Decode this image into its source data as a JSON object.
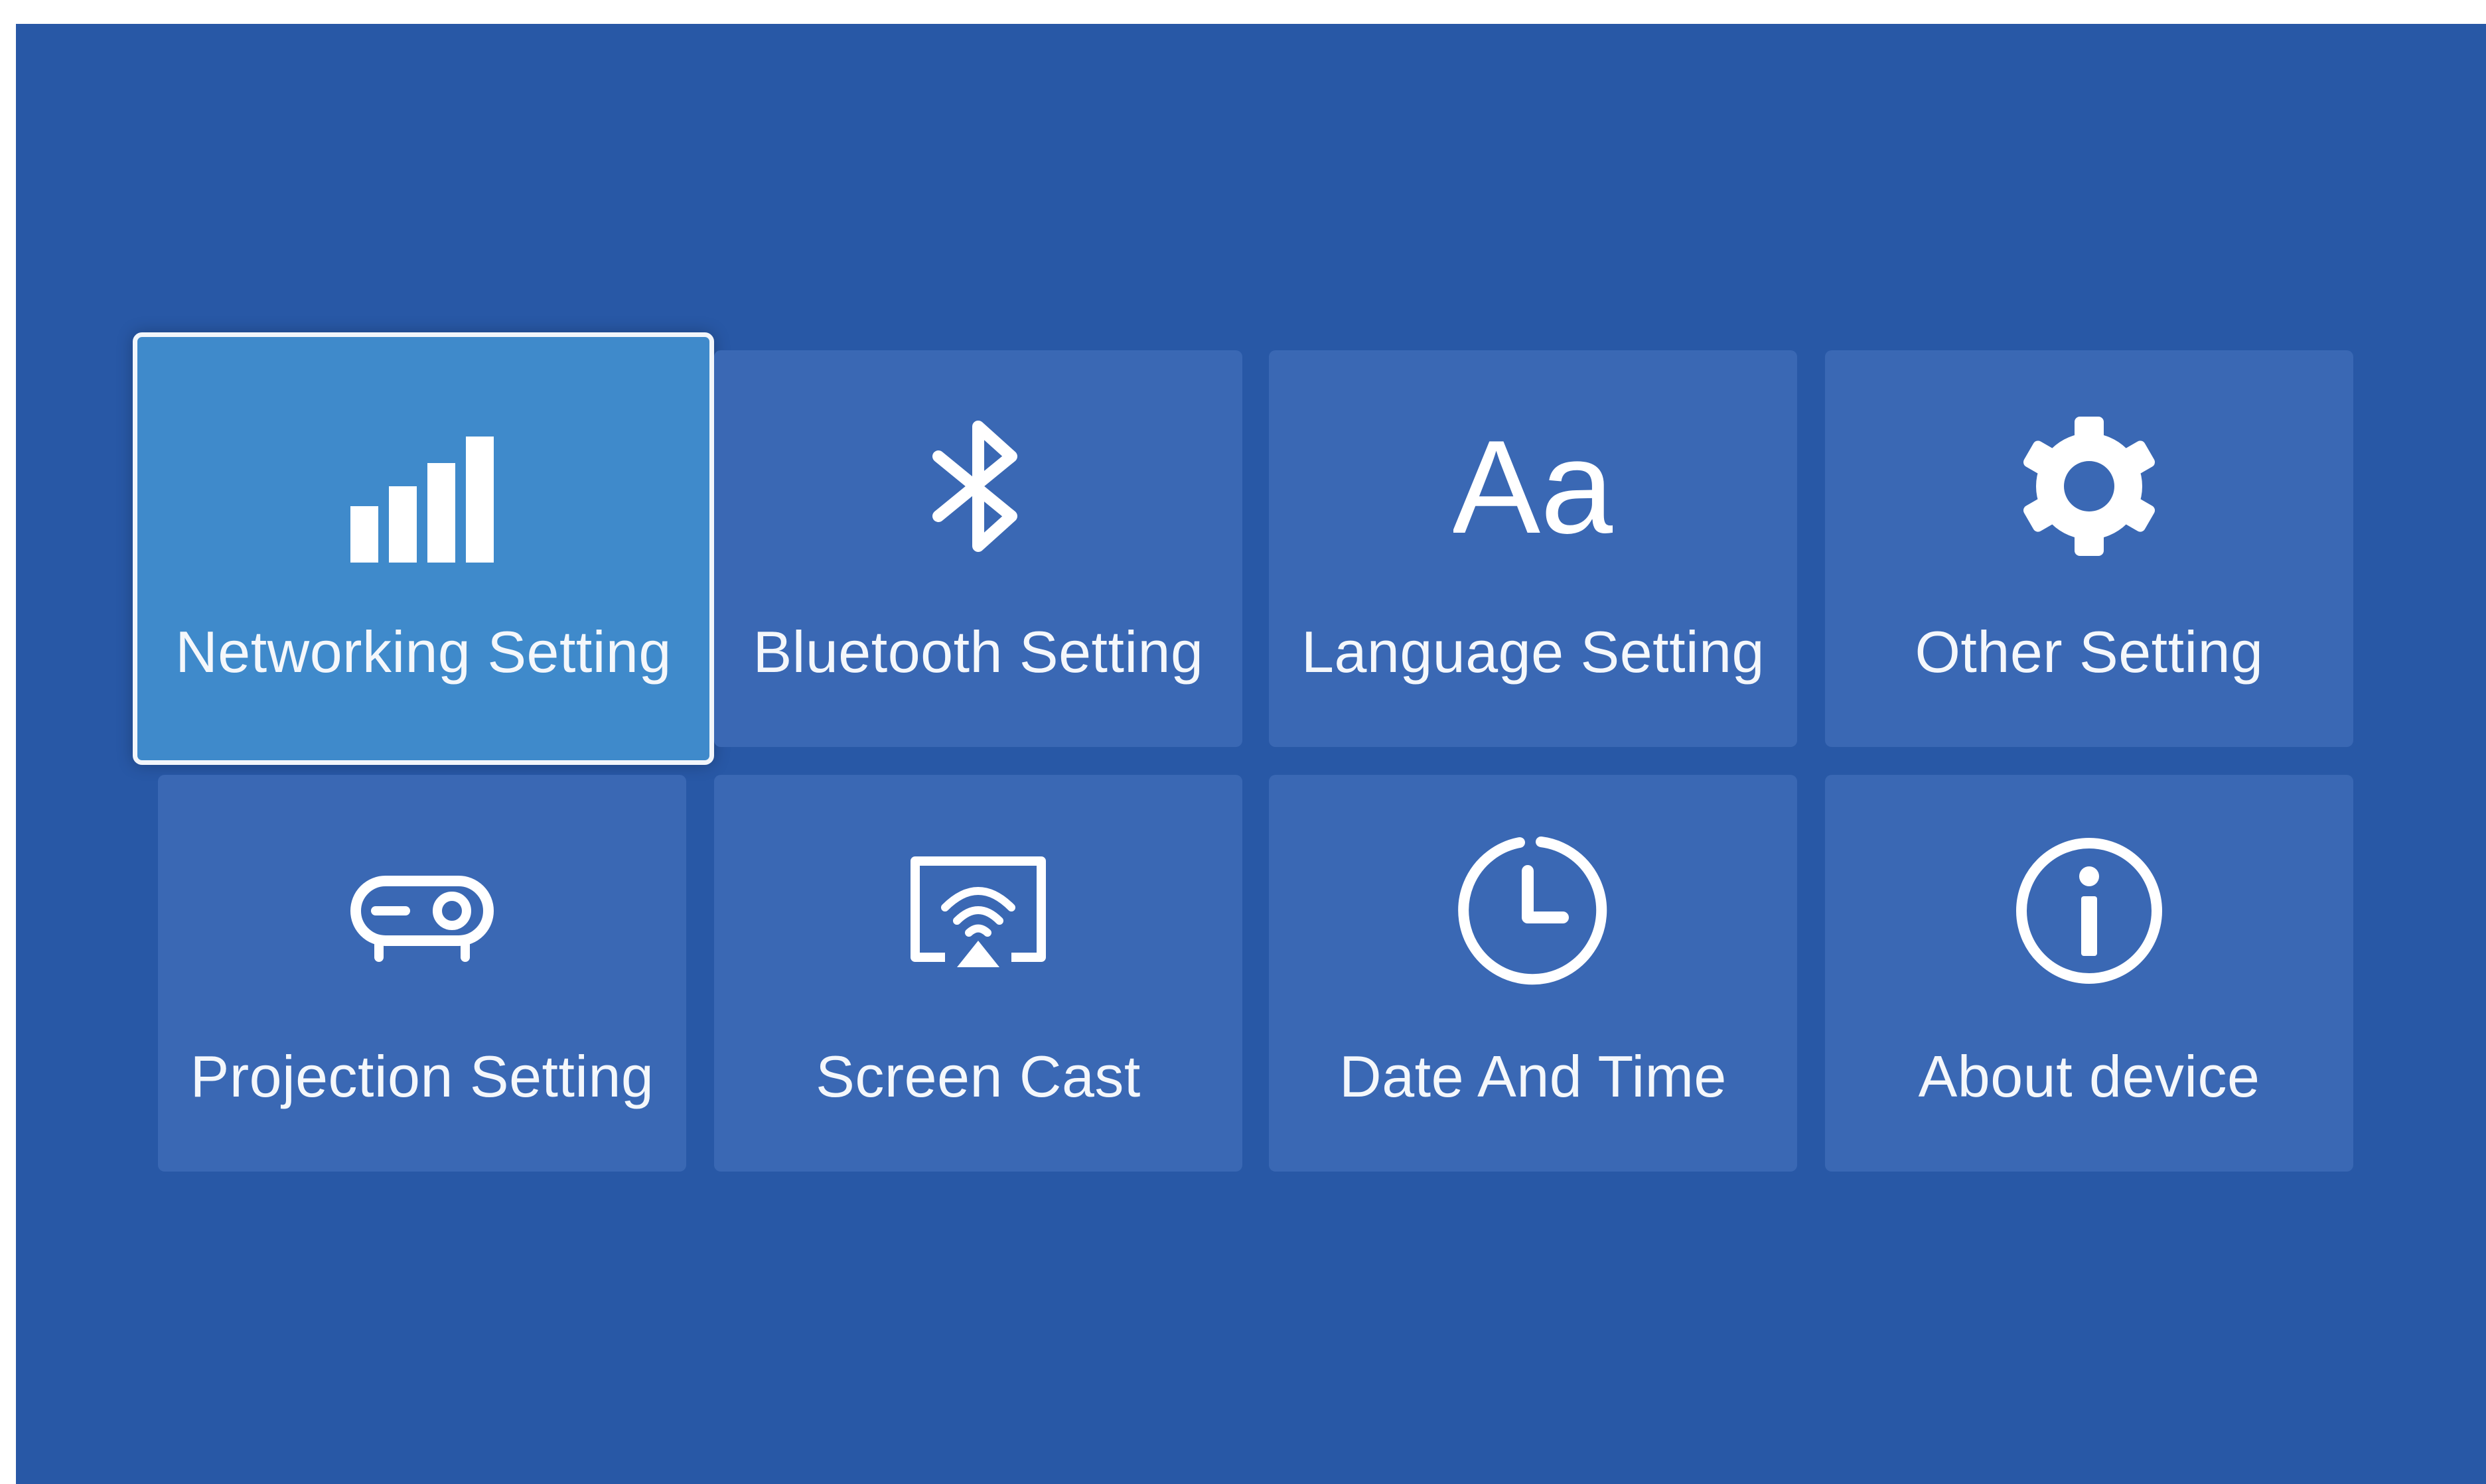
{
  "tiles": [
    {
      "label": "Networking Setting",
      "icon": "signal-bars-icon",
      "selected": true
    },
    {
      "label": "Bluetooth Setting",
      "icon": "bluetooth-icon",
      "selected": false
    },
    {
      "label": "Language Setting",
      "icon": "language-aa-icon",
      "selected": false
    },
    {
      "label": "Other Setting",
      "icon": "gear-icon",
      "selected": false
    },
    {
      "label": "Projection Setting",
      "icon": "projector-icon",
      "selected": false
    },
    {
      "label": "Screen Cast",
      "icon": "screen-cast-icon",
      "selected": false
    },
    {
      "label": "Date And Time",
      "icon": "clock-icon",
      "selected": false
    },
    {
      "label": "About device",
      "icon": "info-icon",
      "selected": false
    }
  ],
  "icons": {
    "language_glyph": "Aa"
  },
  "colors": {
    "background": "#2858a6",
    "tile": "#3a68b4",
    "tile_selected": "#3f8acb",
    "selected_border": "#f2f6fb",
    "text": "#f4f7fb"
  }
}
